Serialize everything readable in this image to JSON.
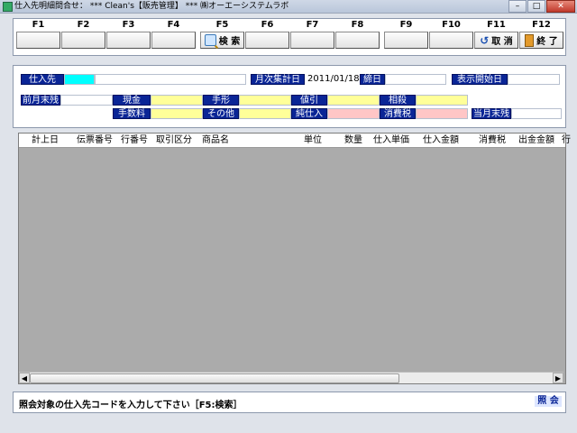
{
  "window": {
    "title": "仕入先明細問合せ：  *** Clean's【販売管理】 *** ㈱オーエーシステムラボ",
    "minimize": "–",
    "maximize": "□",
    "close": "✕"
  },
  "fkeys": [
    {
      "key": "F1",
      "label": ""
    },
    {
      "key": "F2",
      "label": ""
    },
    {
      "key": "F3",
      "label": ""
    },
    {
      "key": "F4",
      "label": ""
    },
    {
      "key": "F5",
      "label": "検 索",
      "icon": "search-icon"
    },
    {
      "key": "F6",
      "label": ""
    },
    {
      "key": "F7",
      "label": ""
    },
    {
      "key": "F8",
      "label": ""
    },
    {
      "key": "F9",
      "label": ""
    },
    {
      "key": "F10",
      "label": ""
    },
    {
      "key": "F11",
      "label": "取 消",
      "icon": "undo-icon"
    },
    {
      "key": "F12",
      "label": "終 了",
      "icon": "exit-icon"
    }
  ],
  "header": {
    "supplier_label": "仕入先",
    "supplier_code": "",
    "supplier_name": "",
    "monthly_date_label": "月次集計日",
    "monthly_date": "2011/01/18",
    "closing_day_label": "締日",
    "closing_day": "",
    "display_start_label": "表示開始日",
    "display_start": "",
    "prev_balance_label": "前月末残",
    "prev_balance": "",
    "cash_label": "現金",
    "cash": "",
    "bill_label": "手形",
    "bill": "",
    "discount_label": "値引",
    "discount": "",
    "offset_label": "相殺",
    "offset": "",
    "fee_label": "手数料",
    "fee": "",
    "other_label": "その他",
    "other": "",
    "net_purchase_label": "純仕入",
    "net_purchase": "",
    "tax_label": "消費税",
    "tax": "",
    "month_end_label": "当月末残",
    "month_end": ""
  },
  "grid": {
    "columns": [
      "計上日",
      "伝票番号",
      "行番号",
      "取引区分",
      "商品名",
      "単位",
      "数量",
      "仕入単価",
      "仕入金額",
      "消費税",
      "出金金額",
      "行"
    ],
    "rows": []
  },
  "status": {
    "message": "照会対象の仕入先コードを入力して下さい［F5:検索］",
    "mode": "照 会"
  },
  "colors": {
    "label_bg": "#0a2596",
    "yellow_field": "#ffff99",
    "pink_field": "#ffc6c6",
    "focus_field": "#00ffff"
  }
}
